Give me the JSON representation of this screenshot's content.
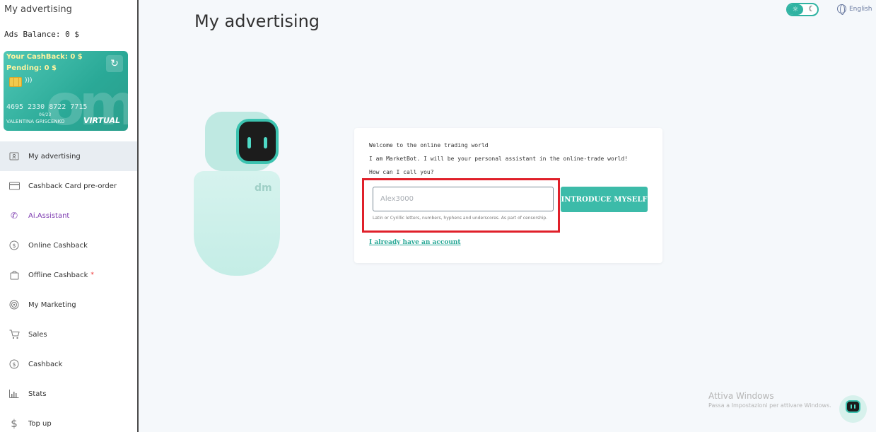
{
  "sidebar": {
    "title": "My advertising",
    "ads_balance": "Ads Balance: 0 $",
    "card": {
      "cashback": "Your CashBack: 0 $",
      "pending": "Pending: 0 $",
      "number": "4695 2330 8722 7715",
      "expiry": "06/23",
      "holder": "VALENTINA GRISCENKO",
      "type": "VIRTUAL",
      "watermark": "om"
    },
    "items": [
      {
        "label": "My advertising",
        "icon": "id-badge-icon",
        "active": true
      },
      {
        "label": "Cashback Card pre-order",
        "icon": "credit-card-icon"
      },
      {
        "label": "Ai.Assistant",
        "icon": "phone-signal-icon"
      },
      {
        "label": "Online Cashback",
        "icon": "dollar-circle-icon"
      },
      {
        "label": "Offline Cashback",
        "icon": "shopping-bag-icon",
        "star": "*"
      },
      {
        "label": "My Marketing",
        "icon": "target-icon"
      },
      {
        "label": "Sales",
        "icon": "cart-icon"
      },
      {
        "label": "Cashback",
        "icon": "dollar-circle-icon"
      },
      {
        "label": "Stats",
        "icon": "bar-chart-icon"
      },
      {
        "label": "Top up",
        "icon": "dollar-icon"
      }
    ]
  },
  "header": {
    "title": "My advertising",
    "language": "English"
  },
  "robot": {
    "logo": "dm"
  },
  "form": {
    "welcome": "Welcome to the online trading world",
    "intro": "I am MarketBot. I will be your personal assistant in the online-trade world!",
    "question": "How can I call you?",
    "name_placeholder": "Alex3000",
    "hint": "Latin or Cyrillic letters, numbers, hyphens and underscores. As part of censorship.",
    "submit_label": "INTRODUCE MYSELF",
    "account_link": "I already have an account"
  },
  "windows_watermark": {
    "line1": "Attiva Windows",
    "line2": "Passa a Impostazioni per attivare Windows."
  },
  "colors": {
    "accent": "#3cbba9",
    "highlight": "#e0202a",
    "purple": "#7d3bb0"
  }
}
